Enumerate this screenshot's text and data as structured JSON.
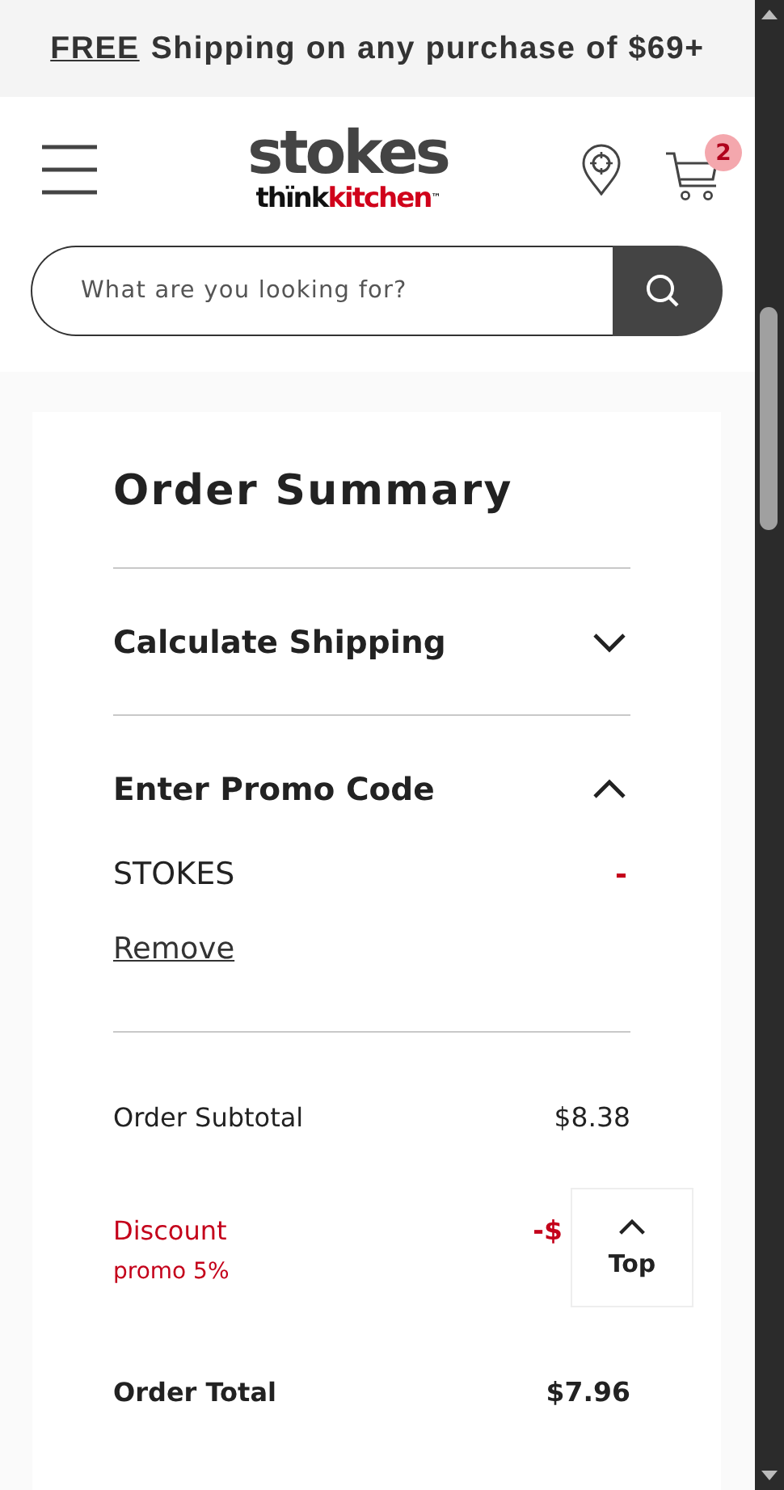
{
  "banner": {
    "highlight": "FREE",
    "text": "Shipping on any purchase of $69+"
  },
  "header": {
    "logo_top": "stokes",
    "logo_bottom_1": "thïnk",
    "logo_bottom_2": "kitchen",
    "logo_mark": "™",
    "cart_count": "2"
  },
  "search": {
    "placeholder": "What are you looking for?"
  },
  "summary": {
    "title": "Order Summary",
    "sections": [
      {
        "label": "Calculate Shipping",
        "expanded": false
      },
      {
        "label": "Enter Promo Code",
        "expanded": true
      }
    ],
    "promo": {
      "code": "STOKES",
      "remove_symbol": "-",
      "remove_link": "Remove"
    },
    "lines": [
      {
        "kind": "subtotal",
        "label": "Order Subtotal",
        "value": "$8.38"
      },
      {
        "kind": "discount",
        "label": "Discount",
        "note": "promo 5%",
        "value": "-$"
      },
      {
        "kind": "total",
        "label": "Order Total",
        "value": "$7.96"
      }
    ]
  },
  "back_to_top": {
    "label": "Top"
  }
}
